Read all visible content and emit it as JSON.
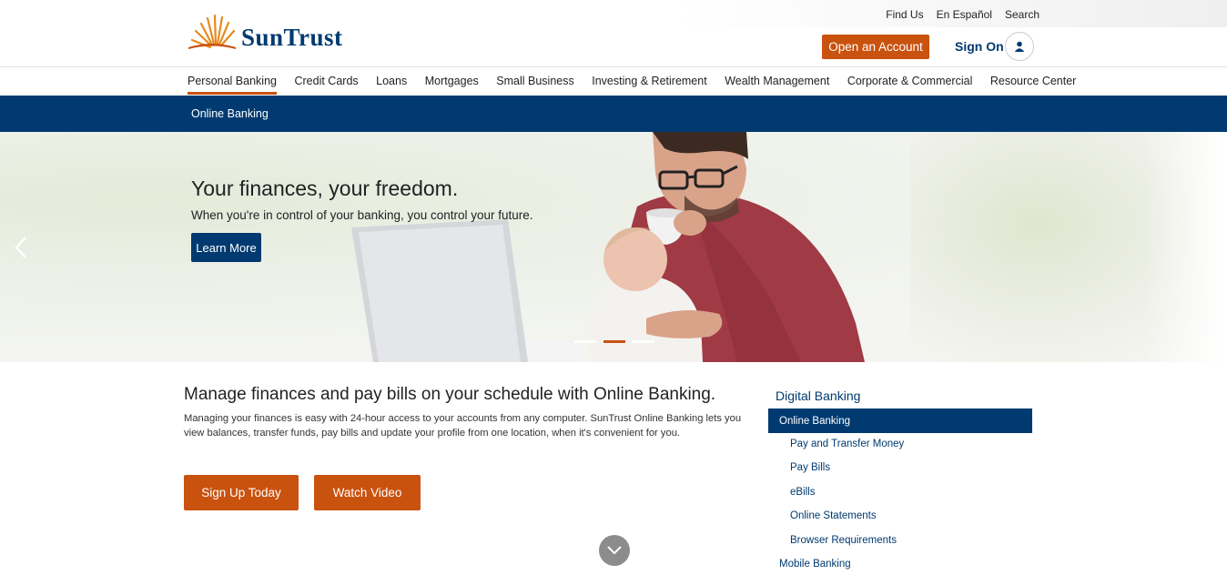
{
  "util_nav": [
    "Find Us",
    "En Español",
    "Search"
  ],
  "brand": {
    "name": "SunTrust",
    "accent": "#c9520f",
    "primary": "#003a70"
  },
  "header": {
    "open_account": "Open an Account",
    "sign_on": "Sign On",
    "user_icon": "user-icon"
  },
  "main_nav": {
    "items": [
      "Personal Banking",
      "Credit Cards",
      "Loans",
      "Mortgages",
      "Small Business",
      "Investing & Retirement",
      "Wealth Management",
      "Corporate & Commercial",
      "Resource Center"
    ],
    "active": "Personal Banking"
  },
  "subnav": {
    "label": "Online Banking"
  },
  "hero": {
    "title": "Your finances, your freedom.",
    "subtitle": "When you're in control of your banking, you control your future.",
    "cta": "Learn More",
    "prev_icon": "chevron-left-icon",
    "slides_total": 3,
    "active_slide": 2
  },
  "content": {
    "title": "Manage finances and pay bills on your schedule with Online Banking.",
    "body": "Managing your finances is easy with 24-hour access to your accounts from any computer. SunTrust Online Banking lets you view balances, transfer funds, pay bills and update your profile from one location, when it's convenient for you.",
    "signup": "Sign Up Today",
    "video": "Watch Video",
    "scroll_icon": "chevron-down-icon"
  },
  "sidebar": {
    "heading": "Digital Banking",
    "active": "Online Banking",
    "sub_items": [
      "Pay and Transfer Money",
      "Pay Bills",
      "eBills",
      "Online Statements",
      "Browser Requirements"
    ],
    "next": "Mobile Banking"
  }
}
